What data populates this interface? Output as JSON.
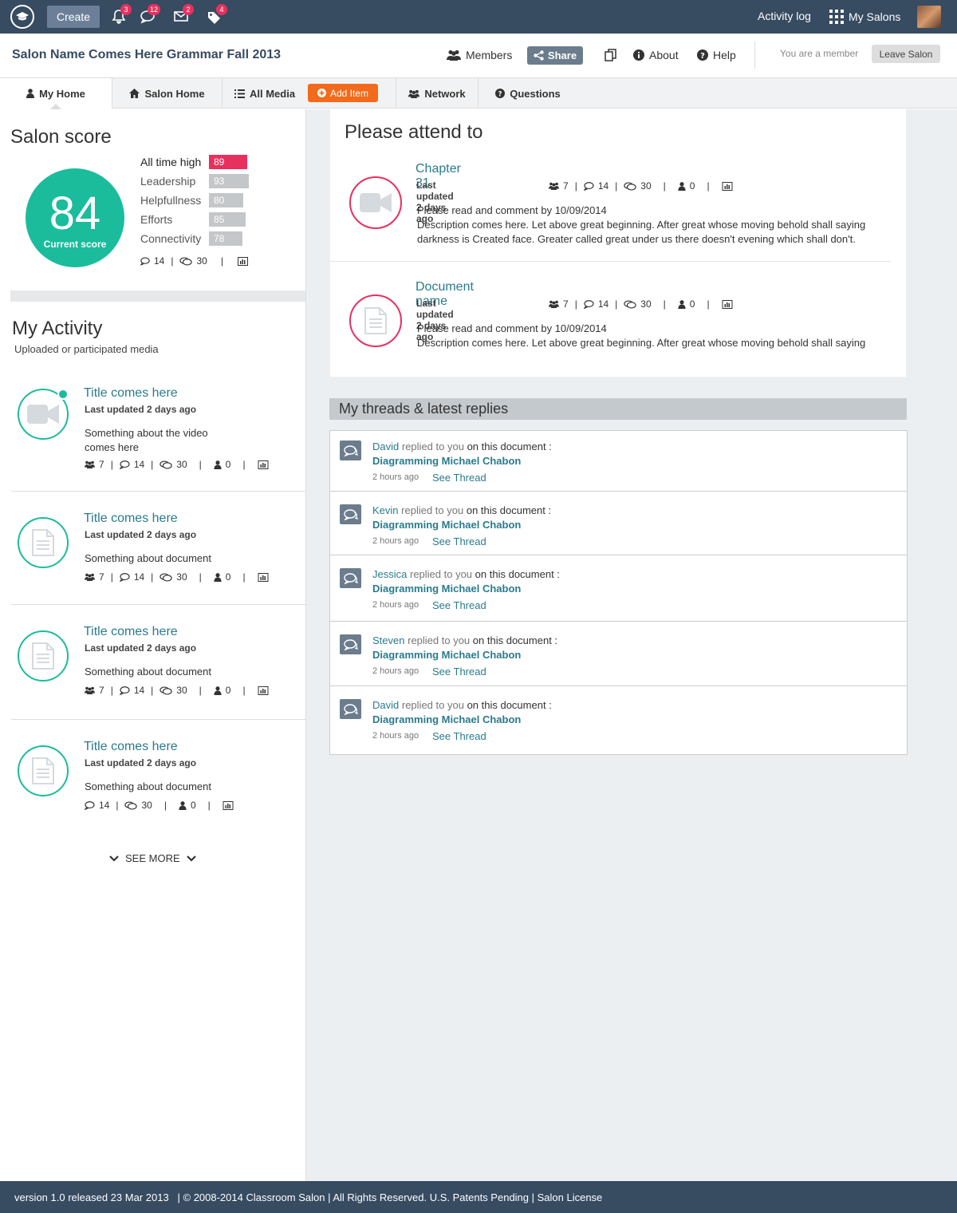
{
  "topbar": {
    "create_label": "Create",
    "badges": {
      "notifications": "3",
      "comments": "12",
      "mail": "2",
      "tags": "4"
    },
    "activity_log": "Activity log",
    "my_salons": "My Salons"
  },
  "header": {
    "title": "Salon Name Comes Here Grammar Fall 2013",
    "members": "Members",
    "share": "Share",
    "about": "About",
    "help": "Help",
    "member_status": "You are a member",
    "leave": "Leave Salon"
  },
  "tabs": {
    "my_home": "My Home",
    "salon_home": "Salon Home",
    "all_media": "All Media",
    "add_item": "Add Item",
    "network": "Network",
    "questions": "Questions"
  },
  "score": {
    "heading": "Salon score",
    "current": "84",
    "current_label": "Current score",
    "rows": [
      {
        "label": "All time high",
        "value": 89
      },
      {
        "label": "Leadership",
        "value": 93
      },
      {
        "label": "Helpfullness",
        "value": 80
      },
      {
        "label": "Efforts",
        "value": 85
      },
      {
        "label": "Connectivity",
        "value": 78
      }
    ],
    "stats": {
      "comments": "14",
      "replies": "30"
    },
    "colors": {
      "highlight": "#e8305f",
      "normal": "#c4c7ca",
      "accent": "#1abc9c"
    }
  },
  "activity": {
    "heading": "My Activity",
    "subheading": "Uploaded or participated media",
    "items": [
      {
        "title": "Title comes here",
        "updated": "Last updated 2 days ago",
        "desc": "Something about the video comes here",
        "members": "7",
        "comments": "14",
        "replies": "30",
        "users": "0"
      },
      {
        "title": "Title comes here",
        "updated": "Last updated 2 days ago",
        "desc": "Something about document",
        "members": "7",
        "comments": "14",
        "replies": "30",
        "users": "0"
      },
      {
        "title": "Title comes here",
        "updated": "Last updated 2 days ago",
        "desc": "Something about document",
        "members": "7",
        "comments": "14",
        "replies": "30",
        "users": "0"
      },
      {
        "title": "Title comes here",
        "updated": "Last updated 2 days ago",
        "desc": "Something about document",
        "comments": "14",
        "replies": "30",
        "users": "0"
      }
    ],
    "see_more": "SEE MORE"
  },
  "attend": {
    "heading": "Please attend to",
    "items": [
      {
        "title": "Chapter 31",
        "updated": "Last updated 2 days ago",
        "members": "7",
        "comments": "14",
        "replies": "30",
        "users": "0",
        "line1": "Please read and comment by 10/09/2014",
        "line2": "Description comes here. Let above great beginning. After great whose moving behold shall saying darkness is Created face. Greater called great under us there doesn't evening which shall don't."
      },
      {
        "title": "Document name",
        "updated": "Last updated 2 days ago",
        "members": "7",
        "comments": "14",
        "replies": "30",
        "users": "0",
        "line1": "Please read and comment by 10/09/2014",
        "line2": "Description comes here. Let above great beginning. After great whose moving behold shall saying"
      }
    ]
  },
  "threads": {
    "heading": "My threads & latest replies",
    "replied": "replied to you",
    "on_doc": "on this document :",
    "items": [
      {
        "name": "David",
        "doc": "Diagramming Michael Chabon",
        "time": "2 hours ago",
        "see": "See Thread"
      },
      {
        "name": "Kevin",
        "doc": "Diagramming Michael Chabon",
        "time": "2 hours ago",
        "see": "See Thread"
      },
      {
        "name": "Jessica",
        "doc": "Diagramming Michael Chabon",
        "time": "2 hours ago",
        "see": "See Thread"
      },
      {
        "name": "Steven",
        "doc": "Diagramming Michael Chabon",
        "time": "2 hours ago",
        "see": "See Thread"
      },
      {
        "name": "David",
        "doc": "Diagramming Michael Chabon",
        "time": "2 hours ago",
        "see": "See Thread"
      }
    ]
  },
  "footer": {
    "text": "version 1.0 released 23 Mar 2013   | © 2008-2014 Classroom Salon | All Rights Reserved. U.S. Patents Pending | Salon License"
  }
}
